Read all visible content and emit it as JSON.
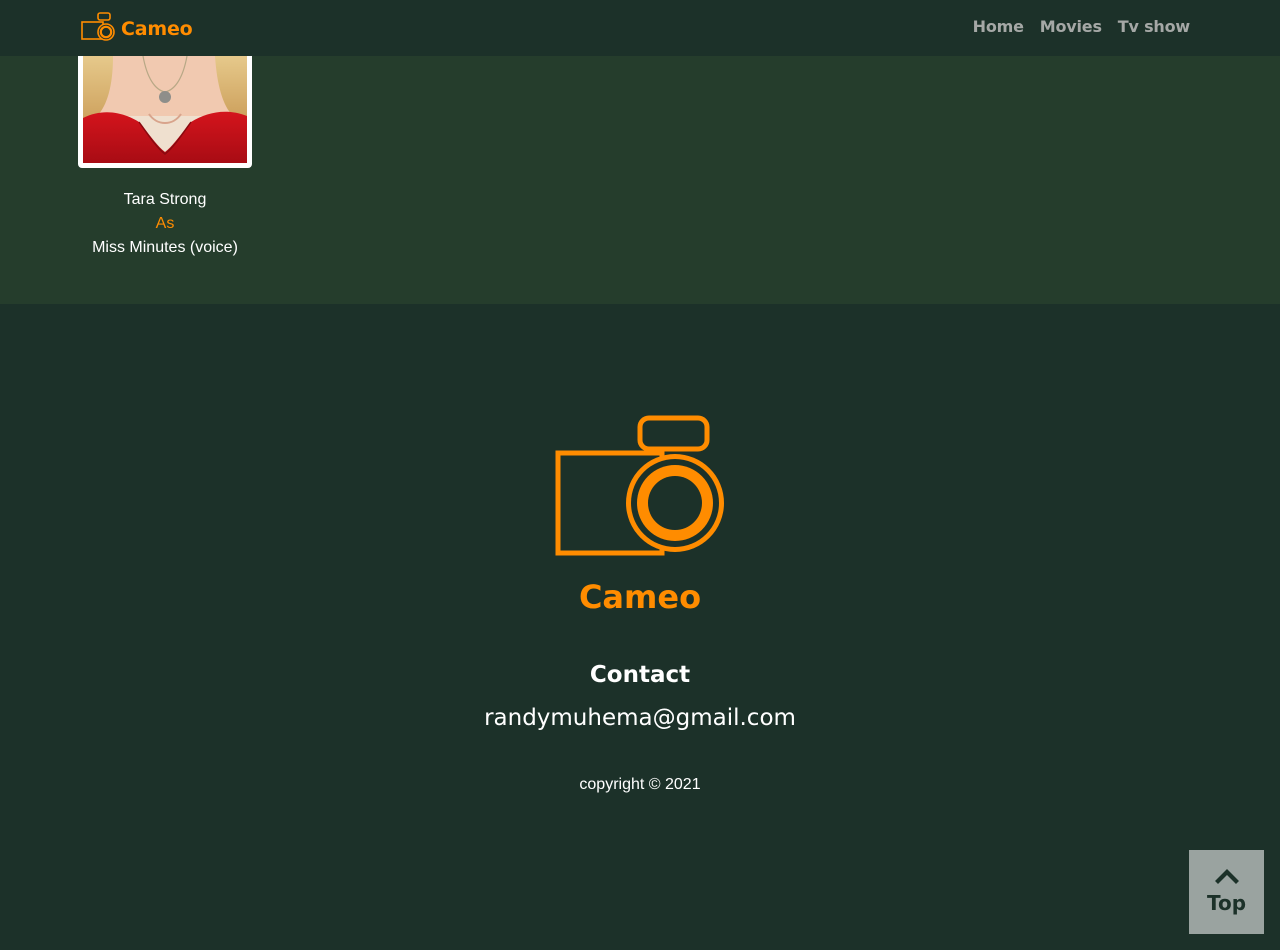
{
  "colors": {
    "accent": "#ff8c00",
    "nav_background": "#1c3129",
    "content_background": "#253d2c",
    "footer_background": "#1c3129",
    "nav_link": "#a5a8a6",
    "top_button_background": "#9aa3a0"
  },
  "navbar": {
    "brand_icon": "camera-icon",
    "brand_name": "Cameo",
    "links": [
      "Home",
      "Movies",
      "Tv show"
    ]
  },
  "cast": [
    {
      "actor": "Tara Strong",
      "as_label": "As",
      "character": "Miss Minutes (voice)"
    }
  ],
  "footer": {
    "logo_icon": "camera-icon",
    "brand_name": "Cameo",
    "contact_heading": "Contact",
    "email": "randymuhema@gmail.com",
    "copyright": "copyright © 2021"
  },
  "scroll_top": {
    "icon": "chevron-up-icon",
    "label": "Top"
  }
}
